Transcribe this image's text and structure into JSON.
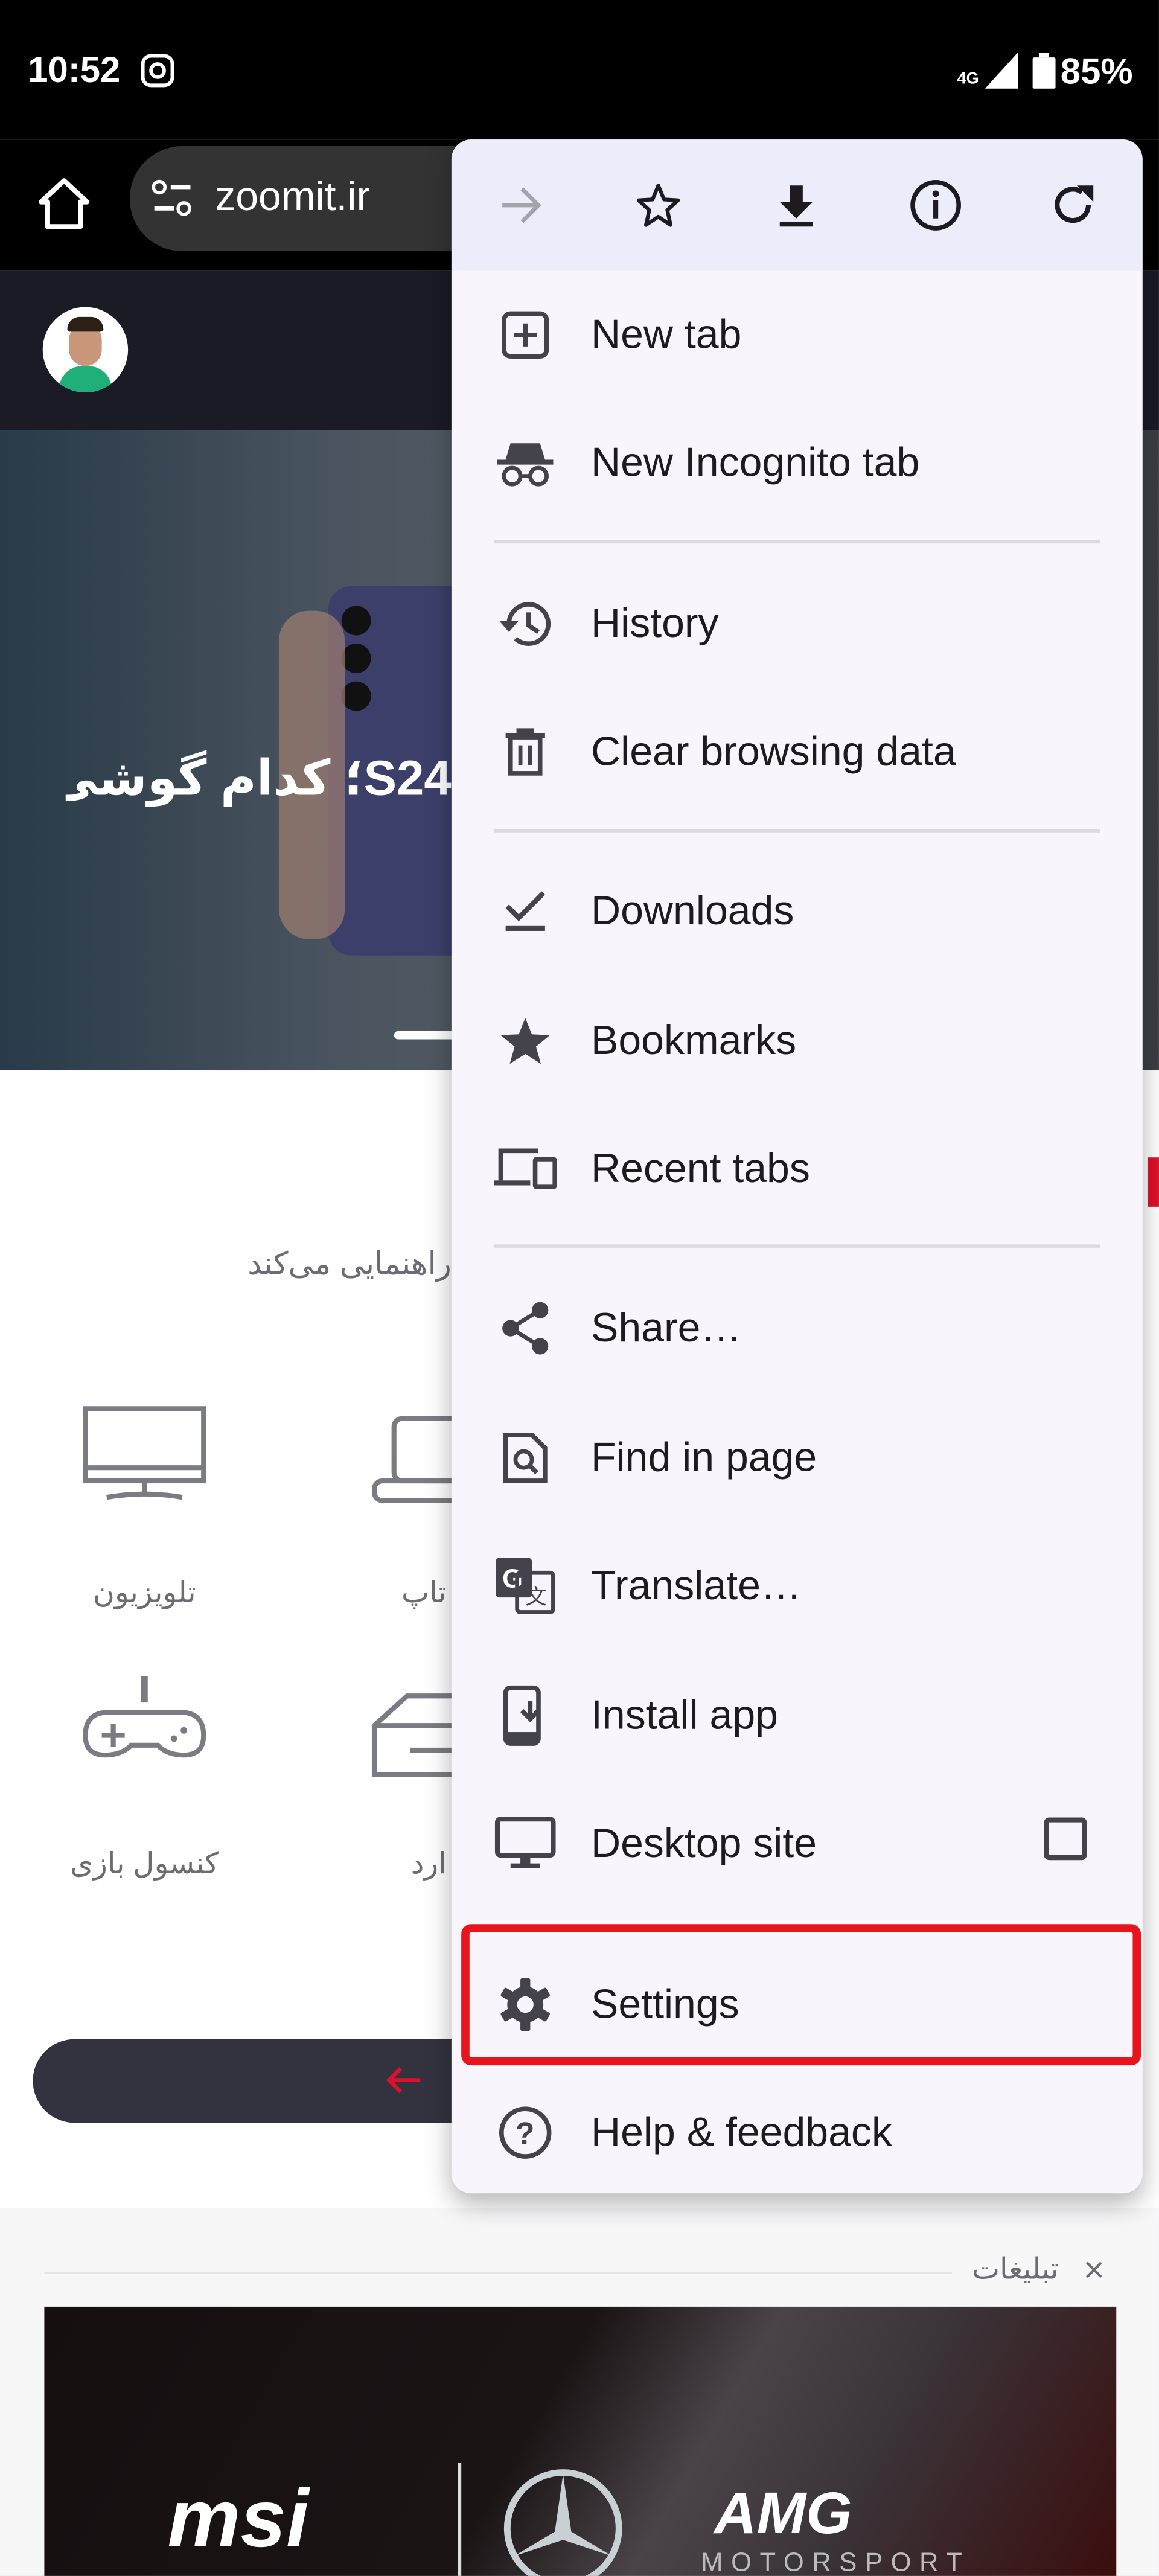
{
  "status_bar": {
    "time": "10:52",
    "network": "4G",
    "battery": "85%",
    "notification_icon": "instagram-icon"
  },
  "browser": {
    "url": "zoomit.ir"
  },
  "hero": {
    "title": "S24؛ کدام گوشی"
  },
  "content": {
    "subtitle": "راهنمایی می‌کند",
    "categories": [
      {
        "label": "تلویزیون",
        "icon": "tv-icon"
      },
      {
        "label": "تاپ",
        "icon": "laptop-icon"
      },
      {
        "label": "کنسول بازی",
        "icon": "gamepad-icon"
      },
      {
        "label": "ارد",
        "icon": "hard-drive-icon"
      }
    ]
  },
  "ad": {
    "label": "تبلیغات",
    "close": "×",
    "brand_text": [
      "msi",
      "AMG",
      "MOTORSPORT"
    ]
  },
  "menu": {
    "top_icons": [
      "forward-icon",
      "bookmark-star-icon",
      "download-icon",
      "info-icon",
      "reload-icon"
    ],
    "items": [
      {
        "label": "New tab",
        "icon": "new-tab-icon"
      },
      {
        "label": "New Incognito tab",
        "icon": "incognito-icon"
      },
      {
        "label": "History",
        "icon": "history-icon"
      },
      {
        "label": "Clear browsing data",
        "icon": "trash-icon"
      },
      {
        "label": "Downloads",
        "icon": "downloads-icon"
      },
      {
        "label": "Bookmarks",
        "icon": "star-icon"
      },
      {
        "label": "Recent tabs",
        "icon": "devices-icon"
      },
      {
        "label": "Share…",
        "icon": "share-icon"
      },
      {
        "label": "Find in page",
        "icon": "find-icon"
      },
      {
        "label": "Translate…",
        "icon": "translate-icon"
      },
      {
        "label": "Install app",
        "icon": "install-app-icon"
      },
      {
        "label": "Desktop site",
        "icon": "desktop-icon",
        "checked": false
      },
      {
        "label": "Settings",
        "icon": "gear-icon",
        "highlighted": true
      },
      {
        "label": "Help & feedback",
        "icon": "help-icon"
      }
    ]
  },
  "colors": {
    "highlight": "#e8141c",
    "menu_bg": "#f8f6fc",
    "menu_top_bg": "#ececfa",
    "accent_red": "#e0102a"
  }
}
